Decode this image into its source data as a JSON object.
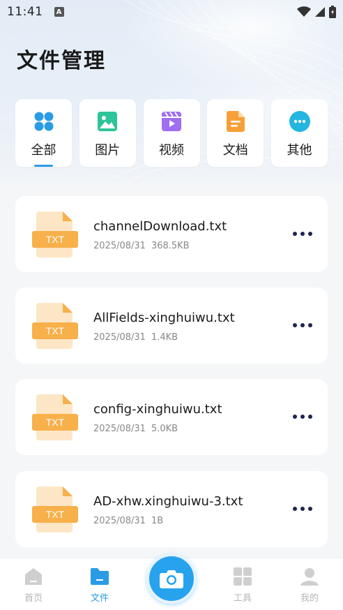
{
  "status_bar": {
    "time": "11:41",
    "notification_badge": "A"
  },
  "header": {
    "title": "文件管理"
  },
  "tabs": [
    {
      "label": "全部",
      "icon": "grid-icon",
      "color": "#2b9be6",
      "active": true
    },
    {
      "label": "图片",
      "icon": "image-icon",
      "color": "#2ec49a",
      "active": false
    },
    {
      "label": "视频",
      "icon": "video-icon",
      "color": "#a06ef0",
      "active": false
    },
    {
      "label": "文档",
      "icon": "document-icon",
      "color": "#f5a03a",
      "active": false
    },
    {
      "label": "其他",
      "icon": "more-icon",
      "color": "#22b6e0",
      "active": false
    }
  ],
  "files": [
    {
      "name": "channelDownload.txt",
      "date": "2025/08/31",
      "size": "368.5KB",
      "type_label": "TXT"
    },
    {
      "name": "AllFields-xinghuiwu.txt",
      "date": "2025/08/31",
      "size": "1.4KB",
      "type_label": "TXT"
    },
    {
      "name": "config-xinghuiwu.txt",
      "date": "2025/08/31",
      "size": "5.0KB",
      "type_label": "TXT"
    },
    {
      "name": "AD-xhw.xinghuiwu-3.txt",
      "date": "2025/08/31",
      "size": "1B",
      "type_label": "TXT"
    }
  ],
  "bottom_nav": [
    {
      "label": "首页",
      "icon": "home-icon",
      "active": false
    },
    {
      "label": "文件",
      "icon": "folder-icon",
      "active": true
    },
    {
      "label": "工具",
      "icon": "tools-icon",
      "active": false
    },
    {
      "label": "我的",
      "icon": "profile-icon",
      "active": false
    }
  ],
  "colors": {
    "accent": "#2b9be6",
    "file_icon": "#f7b04a",
    "more_dots": "#1d2450"
  }
}
